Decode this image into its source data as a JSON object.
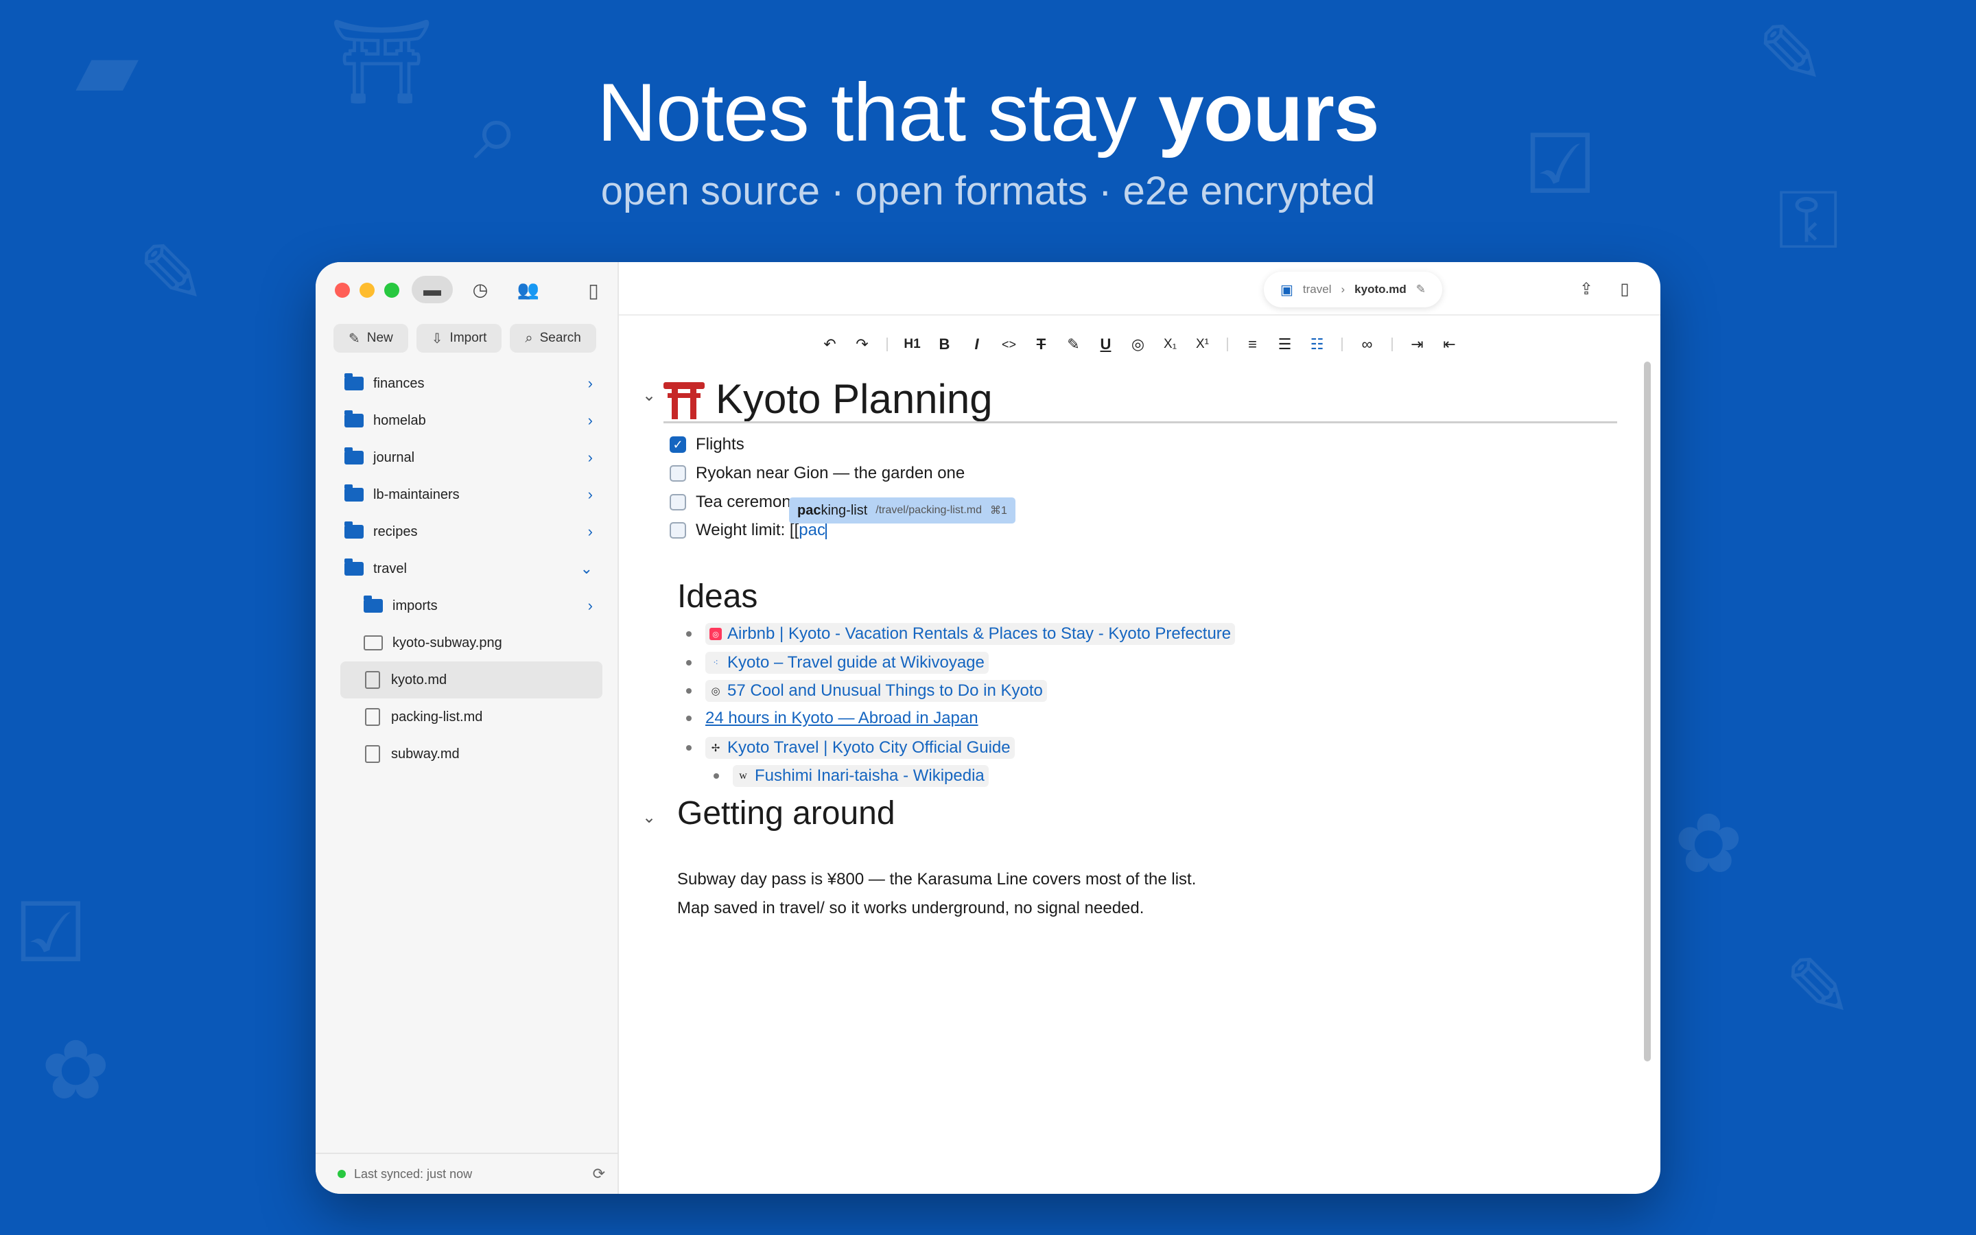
{
  "hero": {
    "title_prefix": "Notes that stay ",
    "title_bold": "yours",
    "subtitle": "open source · open formats · e2e encrypted"
  },
  "colors": {
    "background": "#0a58b8",
    "accent": "#1565c0"
  },
  "sidebar": {
    "actions": {
      "new": "New",
      "import": "Import",
      "search": "Search"
    },
    "tree": [
      {
        "label": "finances",
        "type": "folder"
      },
      {
        "label": "homelab",
        "type": "folder"
      },
      {
        "label": "journal",
        "type": "folder"
      },
      {
        "label": "lb-maintainers",
        "type": "shared-folder"
      },
      {
        "label": "recipes",
        "type": "folder"
      },
      {
        "label": "travel",
        "type": "folder",
        "expanded": true
      },
      {
        "label": "imports",
        "type": "folder"
      },
      {
        "label": "kyoto-subway.png",
        "type": "image"
      },
      {
        "label": "kyoto.md",
        "type": "file",
        "selected": true
      },
      {
        "label": "packing-list.md",
        "type": "file"
      },
      {
        "label": "subway.md",
        "type": "file"
      }
    ],
    "sync_status": "Last synced: just now"
  },
  "topbar": {
    "breadcrumb_folder": "travel",
    "breadcrumb_file": "kyoto.md"
  },
  "toolbar": {
    "h1": "H1",
    "bold": "B",
    "italic": "I",
    "code": "<>",
    "subscript": "X₁",
    "superscript": "X¹"
  },
  "document": {
    "title": "Kyoto Planning",
    "tasks": [
      {
        "label": "Flights",
        "checked": true
      },
      {
        "label": "Ryokan near Gion — the garden one",
        "checked": false
      },
      {
        "label": "Tea ceremon",
        "checked": false
      },
      {
        "label": "Weight limit: [[",
        "typed": "pac",
        "checked": false
      }
    ],
    "autocomplete": {
      "match": "pac",
      "rest": "king-list",
      "path": "/travel/packing-list.md",
      "shortcut": "⌘1"
    },
    "ideas_heading": "Ideas",
    "ideas": [
      {
        "label": "Airbnb | Kyoto - Vacation Rentals & Places to Stay - Kyoto Prefecture",
        "icon": "airbnb-favicon"
      },
      {
        "label": "Kyoto – Travel guide at Wikivoyage",
        "icon": "wikivoyage-favicon"
      },
      {
        "label": "57 Cool and Unusual Things to Do in Kyoto",
        "icon": "atlas-obscura-favicon"
      },
      {
        "label": "24 hours in Kyoto — Abroad in Japan",
        "icon": ""
      },
      {
        "label": "Kyoto Travel | Kyoto City Official Guide",
        "icon": "kyoto-city-favicon"
      },
      {
        "label": "Fushimi Inari-taisha - Wikipedia",
        "icon": "wikipedia-favicon"
      }
    ],
    "getting_around_heading": "Getting around",
    "paragraph_1": "Subway day pass is ¥800 — the Karasuma Line covers most of the list.",
    "paragraph_2": "Map saved in travel/ so it works underground, no signal needed."
  }
}
